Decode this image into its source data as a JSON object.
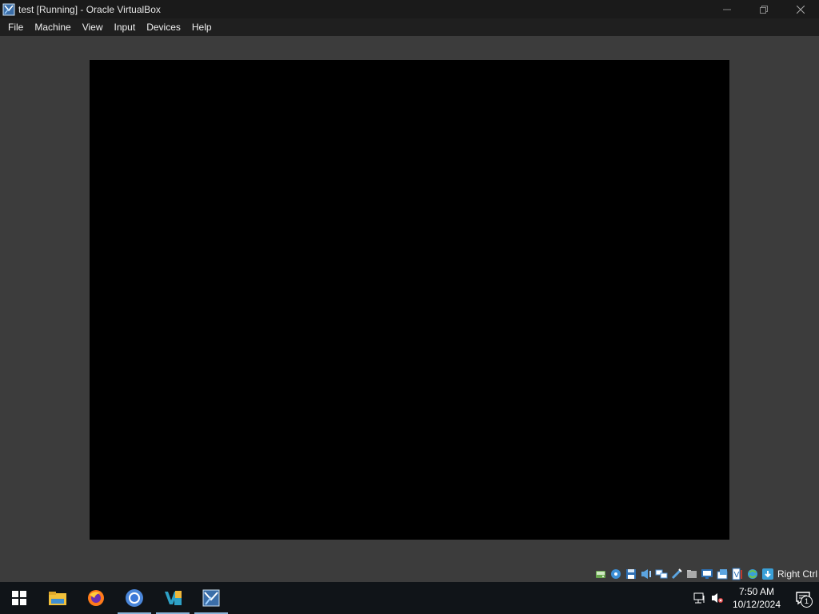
{
  "window": {
    "title": "test [Running] - Oracle VirtualBox",
    "app_icon": "virtualbox-icon",
    "controls": [
      "minimize-icon",
      "restore-icon",
      "close-icon"
    ]
  },
  "menu": {
    "items": [
      {
        "label": "File"
      },
      {
        "label": "Machine"
      },
      {
        "label": "View"
      },
      {
        "label": "Input"
      },
      {
        "label": "Devices"
      },
      {
        "label": "Help"
      }
    ]
  },
  "vm_screen": {
    "state": "black"
  },
  "statusbar": {
    "icons": [
      "hard-disk-icon",
      "optical-drive-icon",
      "floppy-icon",
      "audio-icon",
      "network-icon",
      "usb-icon",
      "shared-folders-icon",
      "display-icon",
      "video-capture-icon",
      "cpu-icon",
      "virtualization-icon",
      "mouse-integration-icon",
      "keyboard-capture-icon"
    ],
    "host_key": "Right Ctrl"
  },
  "taskbar": {
    "apps": [
      {
        "name": "file-explorer-icon",
        "active": false
      },
      {
        "name": "firefox-icon",
        "active": false
      },
      {
        "name": "chrome-icon",
        "active": true
      },
      {
        "name": "visual-studio-icon",
        "active": true
      },
      {
        "name": "virtualbox-icon",
        "active": true
      }
    ],
    "clock": {
      "time": "7:50 AM",
      "date": "10/12/2024"
    },
    "notification_count": "1"
  },
  "colors": {
    "titlebar": "#1a1a1a",
    "menubar": "#1f1f1f",
    "vm_background": "#3c3c3c",
    "taskbar": "#101418",
    "accent": "#8ab4d8"
  }
}
